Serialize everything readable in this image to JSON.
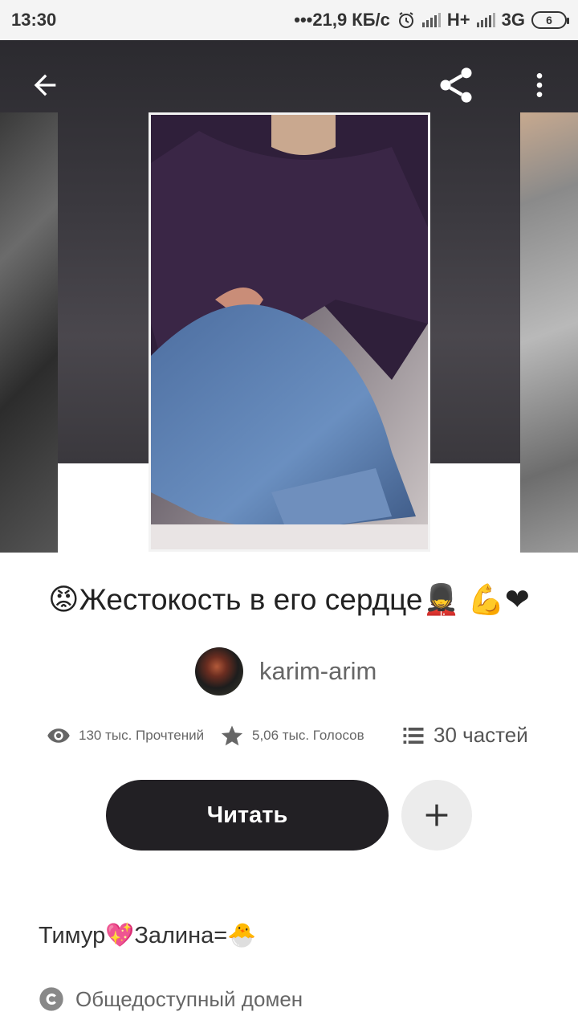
{
  "status_bar": {
    "time": "13:30",
    "network_speed": "•••21,9 КБ/с",
    "network_1": "H+",
    "network_2": "3G",
    "battery": "6"
  },
  "header": {
    "back_icon": "arrow-back-icon",
    "share_icon": "share-icon",
    "more_icon": "more-vert-icon"
  },
  "story": {
    "title": "😡Жестокость в его сердце💂 💪❤",
    "author": "karim-arim",
    "views": "130 тыс. Прочтений",
    "votes": "5,06 тыс. Голосов",
    "parts": "30 частей",
    "read_label": "Читать",
    "description": "Тимур💖Залина=🐣",
    "license": "Общедоступный домен"
  },
  "colors": {
    "read_button": "#222024",
    "add_button": "#ececec",
    "hero_bg": "#3b393f"
  }
}
